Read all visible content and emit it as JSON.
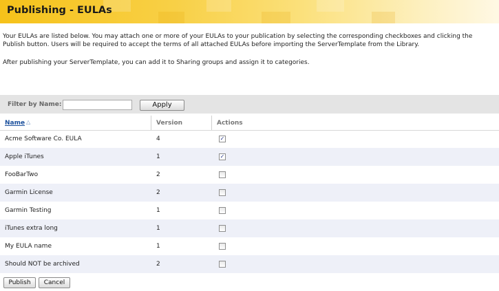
{
  "page": {
    "title": "Publishing - EULAs",
    "intro": "Your EULAs are listed below. You may attach one or more of your EULAs to your publication by selecting the corresponding checkboxes and clicking the Publish button. Users will be required to accept the terms of all attached EULAs before importing the ServerTemplate from the Library.",
    "note": "After publishing your ServerTemplate, you can add it to Sharing groups and assign it to categories."
  },
  "filter": {
    "label": "Filter by Name:",
    "value": "",
    "apply_label": "Apply"
  },
  "table": {
    "columns": {
      "name": "Name",
      "version": "Version",
      "actions": "Actions"
    },
    "sort_icon": "sort-ascending-icon",
    "rows": [
      {
        "name": "Acme Software Co. EULA",
        "version": "4",
        "checked": true
      },
      {
        "name": "Apple iTunes",
        "version": "1",
        "checked": true
      },
      {
        "name": "FooBarTwo",
        "version": "2",
        "checked": false
      },
      {
        "name": "Garmin License",
        "version": "2",
        "checked": false
      },
      {
        "name": "Garmin Testing",
        "version": "1",
        "checked": false
      },
      {
        "name": "iTunes extra long",
        "version": "1",
        "checked": false
      },
      {
        "name": "My EULA name",
        "version": "1",
        "checked": false
      },
      {
        "name": "Should NOT be archived",
        "version": "2",
        "checked": false
      }
    ]
  },
  "actions": {
    "publish_label": "Publish",
    "cancel_label": "Cancel"
  },
  "colors": {
    "header_gold": "#f6c21a",
    "alt_row": "#eef0f8",
    "link_blue": "#1a4f9c"
  }
}
